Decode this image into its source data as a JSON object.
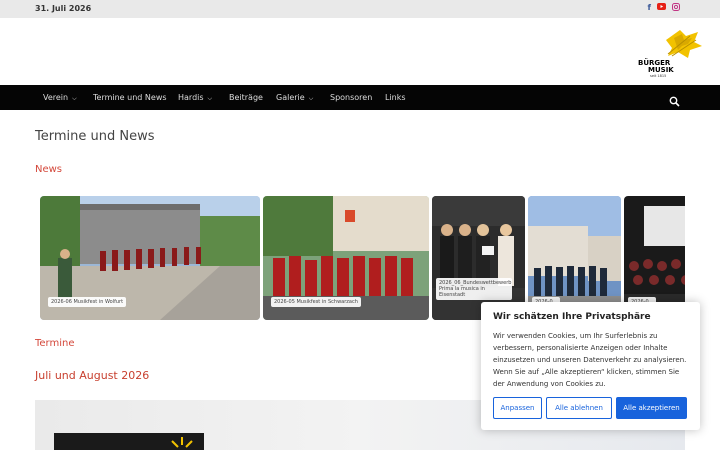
{
  "topbar": {
    "date": "31. Juli 2026",
    "social": [
      "facebook-icon",
      "youtube-icon",
      "instagram-icon"
    ]
  },
  "logo": {
    "line1": "BÜRGER",
    "line2": "MUSIK",
    "year": "seit 1815"
  },
  "nav": {
    "items": [
      {
        "label": "Verein",
        "dropdown": true
      },
      {
        "label": "Termine und News",
        "dropdown": false
      },
      {
        "label": "Hardis",
        "dropdown": true
      },
      {
        "label": "Beiträge",
        "dropdown": false
      },
      {
        "label": "Galerie",
        "dropdown": true
      },
      {
        "label": "Sponsoren",
        "dropdown": false
      },
      {
        "label": "Links",
        "dropdown": false
      }
    ]
  },
  "main": {
    "title": "Termine und News",
    "news_heading": "News",
    "gallery": [
      {
        "caption": "2026-06 Musikfest in Wolfurt"
      },
      {
        "caption": "2026-05 Musikfest in Schwarzach"
      },
      {
        "caption": "2026_06_Bundeswettbewerb Prima la musica in Eisenstadt"
      },
      {
        "caption": "2026-0..."
      },
      {
        "caption": "2026-0..."
      }
    ],
    "termine_heading": "Termine",
    "month_heading": "Juli und August 2026"
  },
  "cookie": {
    "title": "Wir schätzen Ihre Privatsphäre",
    "text": "Wir verwenden Cookies, um Ihr Surferlebnis zu verbessern, personalisierte Anzeigen oder Inhalte einzusetzen und unseren Datenverkehr zu analysieren. Wenn Sie auf „Alle akzeptieren“ klicken, stimmen Sie der Anwendung von Cookies zu.",
    "btn_customize": "Anpassen",
    "btn_reject": "Alle ablehnen",
    "btn_accept": "Alle akzeptieren"
  },
  "colors": {
    "nav_bg": "#050505",
    "accent_red": "#d4483b",
    "cookie_blue": "#1863dc",
    "logo_gold": "#f2c200"
  }
}
